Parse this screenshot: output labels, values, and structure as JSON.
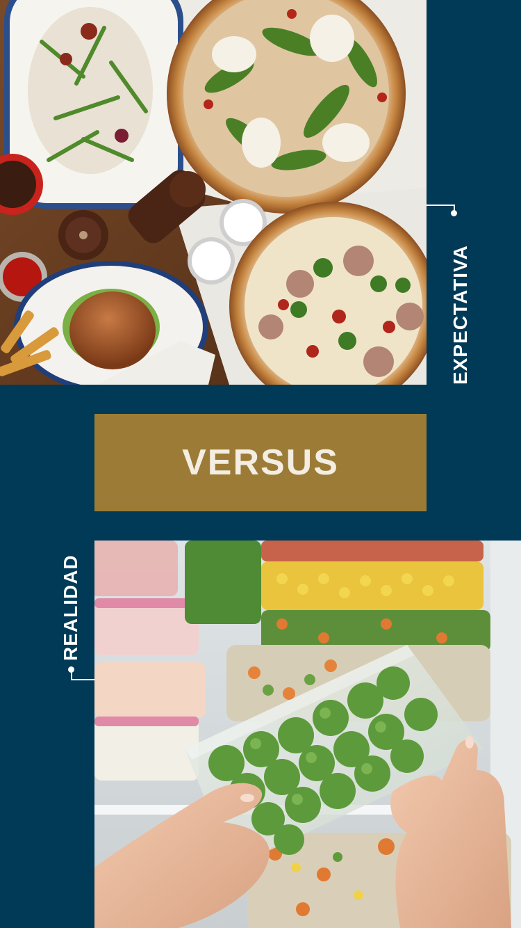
{
  "banner": {
    "label": "VERSUS",
    "background_color": "#9b7b36",
    "text_color": "#f3ede2"
  },
  "labels": {
    "expectation": "EXPECTATIVA",
    "reality": "REALIDAD"
  },
  "photos": {
    "top_subject": "restaurant-food-spread-photo",
    "bottom_subject": "frozen-vegetables-freezer-photo"
  },
  "colors": {
    "background": "#003a57",
    "label": "#ffffff"
  }
}
